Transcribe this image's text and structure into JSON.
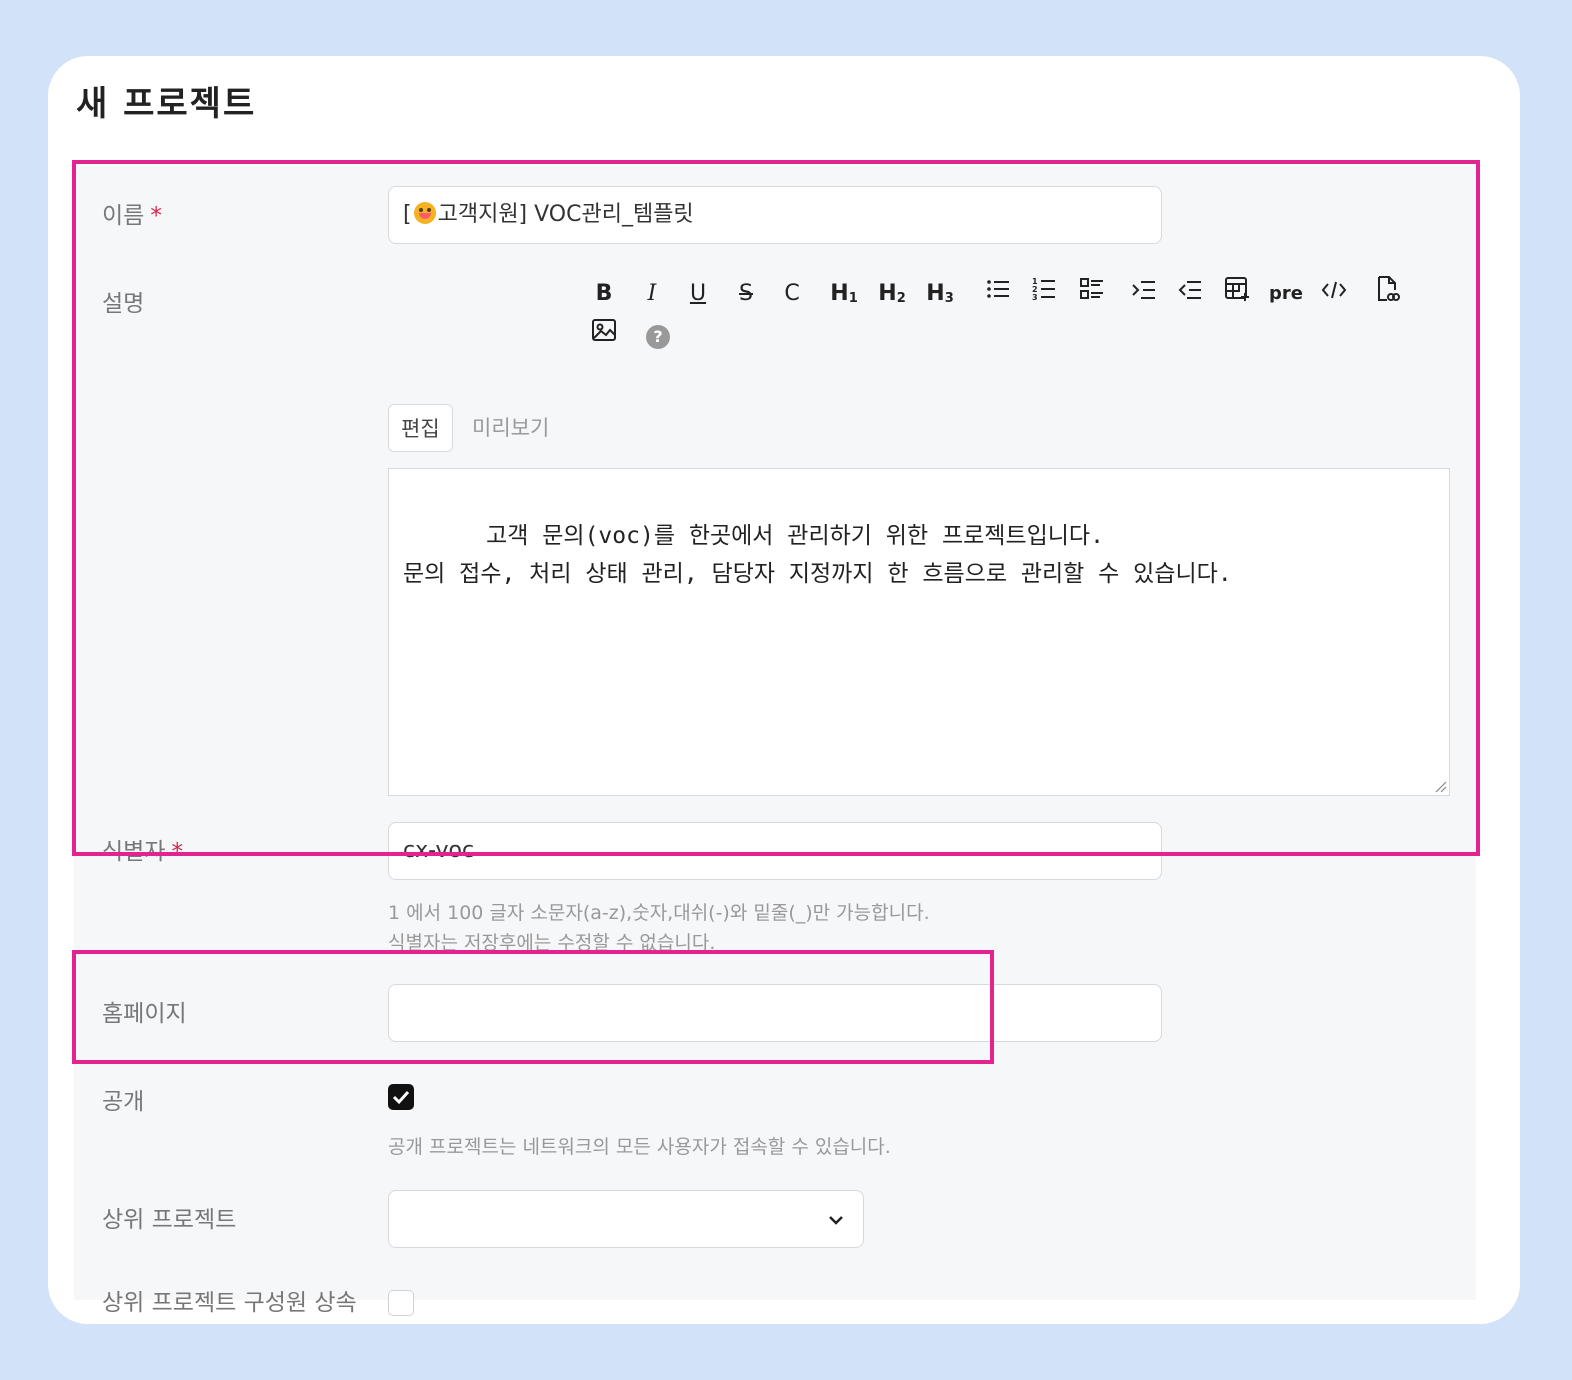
{
  "page": {
    "title": "새 프로젝트"
  },
  "form": {
    "name": {
      "label": "이름",
      "required": "*",
      "value_prefix": "[",
      "value_suffix": "고객지원] VOC관리_템플릿"
    },
    "description": {
      "label": "설명",
      "tabs": [
        {
          "label": "편집"
        },
        {
          "label": "미리보기"
        }
      ],
      "toolbar": {
        "bold": "B",
        "italic": "I",
        "underline": "U",
        "strike": "S",
        "code": "C",
        "h1": "H",
        "h1_sub": "1",
        "h2": "H",
        "h2_sub": "2",
        "h3": "H",
        "h3_sub": "3",
        "pre": "pre",
        "help": "?"
      },
      "value": "고객 문의(voc)를 한곳에서 관리하기 위한 프로젝트입니다.\n문의 접수, 처리 상태 관리, 담당자 지정까지 한 흐름으로 관리할 수 있습니다."
    },
    "identifier": {
      "label": "식별자",
      "required": "*",
      "value": "cx-voc",
      "hint_line1": "1 에서 100 글자 소문자(a-z),숫자,대쉬(-)와 밑줄(_)만 가능합니다.",
      "hint_line2": "식별자는 저장후에는 수정할 수 없습니다."
    },
    "homepage": {
      "label": "홈페이지",
      "value": ""
    },
    "public": {
      "label": "공개",
      "checked": true,
      "hint": "공개 프로젝트는 네트워크의 모든 사용자가 접속할 수 있습니다."
    },
    "parent_project": {
      "label": "상위 프로젝트",
      "value": ""
    },
    "inherit_members": {
      "label": "상위 프로젝트 구성원 상속",
      "checked": false
    }
  },
  "colors": {
    "highlight": "#e3238f",
    "required": "#d9254a",
    "background": "#d2e3f9"
  }
}
